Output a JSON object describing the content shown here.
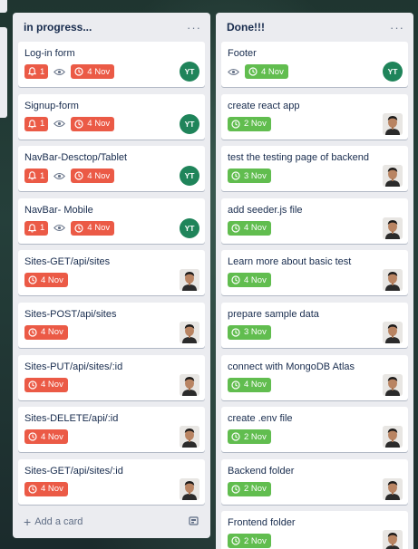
{
  "lists": [
    {
      "title": "in progress...",
      "add_card_label": "Add a card",
      "cards": [
        {
          "title": "Log-in form",
          "notif": "1",
          "watch": true,
          "date": "4 Nov",
          "date_color": "red",
          "member": "initials",
          "initials": "YT"
        },
        {
          "title": "Signup-form",
          "notif": "1",
          "watch": true,
          "date": "4 Nov",
          "date_color": "red",
          "member": "initials",
          "initials": "YT"
        },
        {
          "title": "NavBar-Desctop/Tablet",
          "notif": "1",
          "watch": true,
          "date": "4 Nov",
          "date_color": "red",
          "member": "initials",
          "initials": "YT"
        },
        {
          "title": "NavBar- Mobile",
          "notif": "1",
          "watch": true,
          "date": "4 Nov",
          "date_color": "red",
          "member": "initials",
          "initials": "YT"
        },
        {
          "title": "Sites-GET/api/sites",
          "date": "4 Nov",
          "date_color": "red",
          "member": "photo"
        },
        {
          "title": "Sites-POST/api/sites",
          "date": "4 Nov",
          "date_color": "red",
          "member": "photo"
        },
        {
          "title": "Sites-PUT/api/sites/:id",
          "date": "4 Nov",
          "date_color": "red",
          "member": "photo"
        },
        {
          "title": "Sites-DELETE/api/:id",
          "date": "4 Nov",
          "date_color": "red",
          "member": "photo"
        },
        {
          "title": "Sites-GET/api/sites/:id",
          "date": "4 Nov",
          "date_color": "red",
          "member": "photo"
        }
      ]
    },
    {
      "title": "Done!!!",
      "cards": [
        {
          "title": "Footer",
          "watch": true,
          "date": "4 Nov",
          "date_color": "green",
          "member": "initials",
          "initials": "YT"
        },
        {
          "title": "create react app",
          "date": "2 Nov",
          "date_color": "green",
          "member": "photo"
        },
        {
          "title": "test the testing page of backend",
          "date": "3 Nov",
          "date_color": "green",
          "member": "photo"
        },
        {
          "title": "add seeder.js file",
          "date": "4 Nov",
          "date_color": "green",
          "member": "photo"
        },
        {
          "title": "Learn more about basic test",
          "date": "4 Nov",
          "date_color": "green",
          "member": "photo"
        },
        {
          "title": "prepare sample data",
          "date": "3 Nov",
          "date_color": "green",
          "member": "photo"
        },
        {
          "title": "connect with MongoDB Atlas",
          "date": "4 Nov",
          "date_color": "green",
          "member": "photo"
        },
        {
          "title": "create .env file",
          "date": "2 Nov",
          "date_color": "green",
          "member": "photo"
        },
        {
          "title": "Backend folder",
          "date": "2 Nov",
          "date_color": "green",
          "member": "photo"
        },
        {
          "title": "Frontend folder",
          "date": "2 Nov",
          "date_color": "green",
          "member": "photo"
        }
      ]
    }
  ],
  "colors": {
    "red": "#eb5a46",
    "green": "#61bd4f",
    "avatar": "#1f845a"
  },
  "icons": {
    "menu": "ellipsis-icon",
    "notif": "bell-icon",
    "watch": "eye-icon",
    "date": "clock-icon",
    "add": "plus-icon",
    "template": "card-template-icon"
  }
}
